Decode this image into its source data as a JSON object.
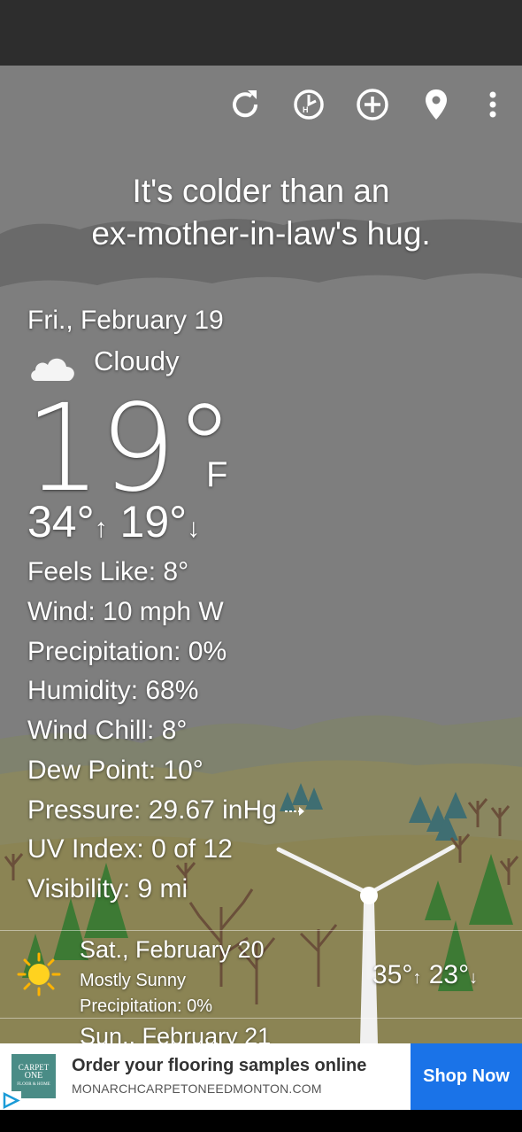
{
  "toolbar": {
    "icons": [
      "refresh-icon",
      "history-icon",
      "add-location-icon",
      "location-pin-icon",
      "more-vert-icon"
    ]
  },
  "quote": {
    "line1": "It's colder than an",
    "line2": "ex-mother-in-law's hug."
  },
  "current": {
    "date": "Fri., February 19",
    "condition": "Cloudy",
    "condition_icon": "cloud-icon",
    "temperature": "19°",
    "unit": "F",
    "high": "34°",
    "high_arrow": "↑",
    "low": "19°",
    "low_arrow": "↓",
    "details": [
      "Feels Like: 8°",
      "Wind: 10 mph W",
      "Precipitation: 0%",
      "Humidity: 68%",
      "Wind Chill: 8°",
      "Dew Point: 10°",
      "Pressure: 29.67 inHg",
      "UV Index: 0 of 12",
      "Visibility: 9 mi"
    ],
    "pressure_trend_icon": "arrow-right-icon"
  },
  "forecast": [
    {
      "day": "Sat., February 20",
      "condition": "Mostly Sunny",
      "precipitation": "Precipitation: 0%",
      "icon": "sun-icon",
      "high": "35°",
      "high_arrow": "↑",
      "low": "23°",
      "low_arrow": "↓"
    },
    {
      "day": "Sun., February 21"
    }
  ],
  "ad": {
    "logo_line1": "CARPET",
    "logo_line2": "ONE",
    "logo_line3": "FLOOR & HOME",
    "title": "Order your flooring samples online",
    "url": "MONARCHCARPETONEEDMONTON.COM",
    "cta": "Shop Now",
    "adchoices_icon": "adchoices-icon"
  },
  "colors": {
    "status_bar": "#2d2d2d",
    "sky": "#7e7e7e",
    "ad_button": "#1a73e8",
    "logo": "#4a8c86"
  }
}
